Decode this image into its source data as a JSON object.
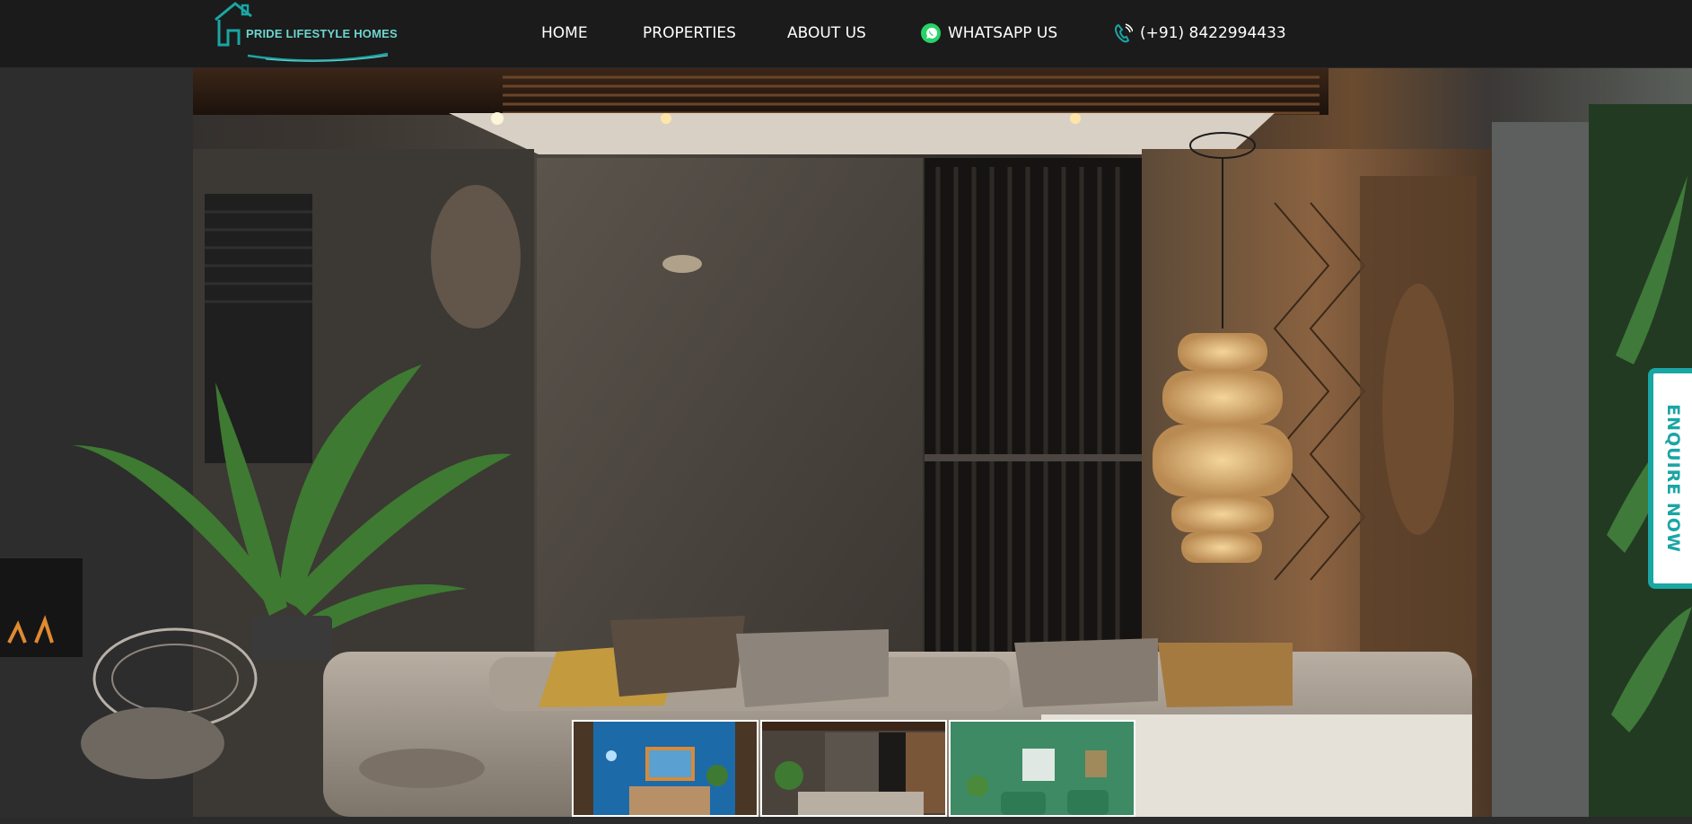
{
  "brand": {
    "name": "PRIDE LIFESTYLE HOMES",
    "accent": "#1aa6a4",
    "logo_icon": "house-roof-icon"
  },
  "nav": {
    "home": "HOME",
    "properties": "PROPERTIES",
    "about": "ABOUT US",
    "whatsapp": "WHATSAPP US",
    "phone": "(+91) 8422994433",
    "whatsapp_icon": "whatsapp-icon",
    "phone_icon": "phone-icon"
  },
  "hero": {
    "description": "luxury living room interior with sofa, plant and woven pendant lamp"
  },
  "enquire": {
    "label": "ENQUIRE NOW"
  },
  "thumbnails": [
    {
      "label": "blue accent wall interior"
    },
    {
      "label": "dark living room interior"
    },
    {
      "label": "green wall interior"
    }
  ]
}
